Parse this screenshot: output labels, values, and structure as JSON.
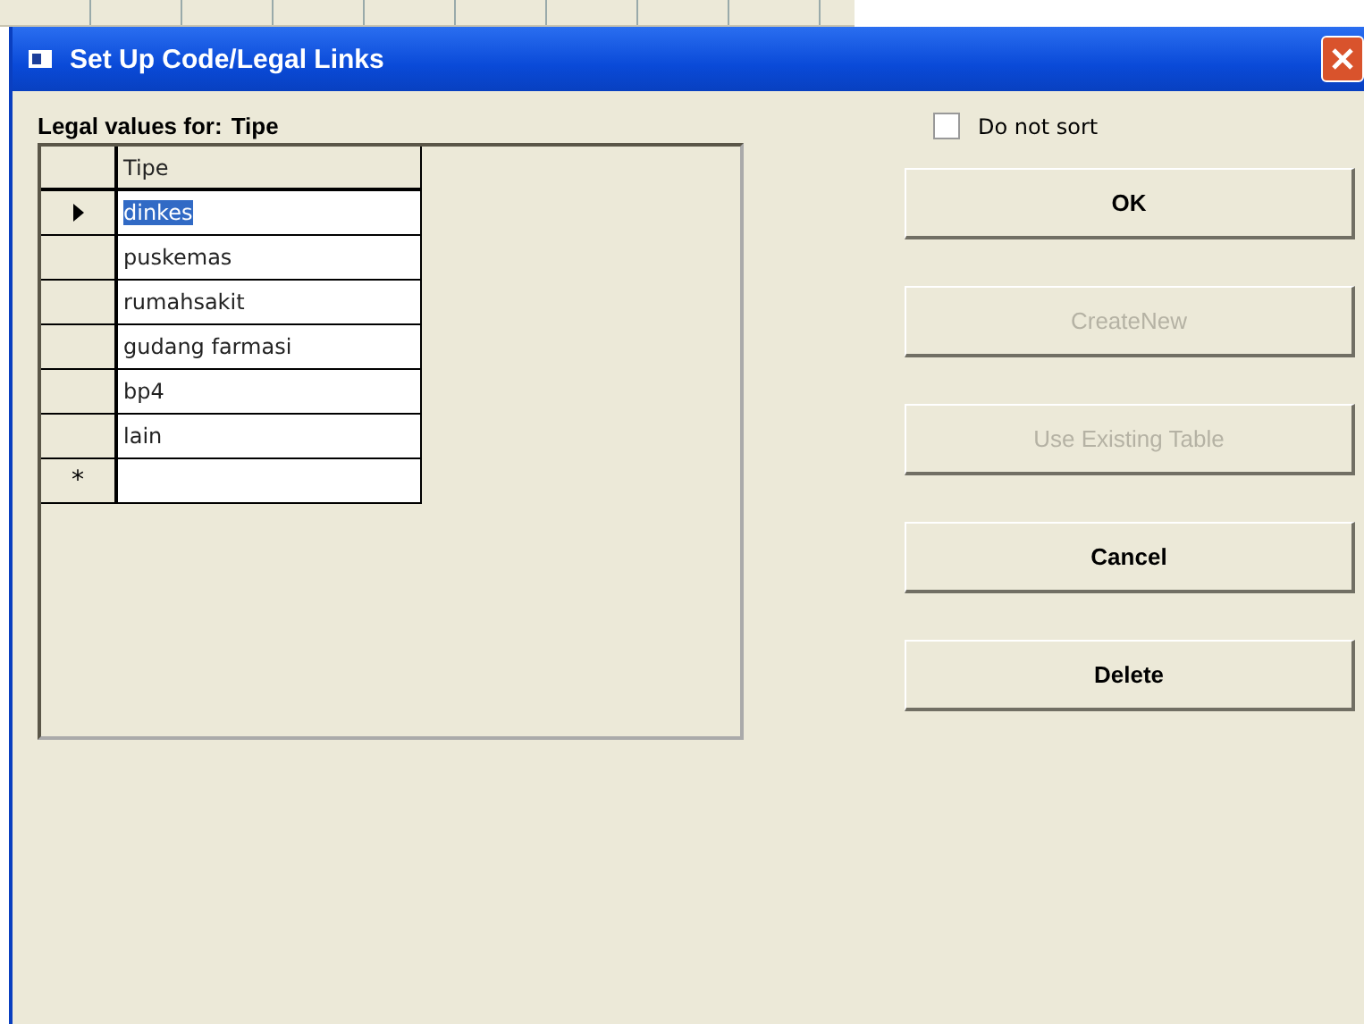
{
  "window": {
    "title": "Set Up Code/Legal Links"
  },
  "legal_label": {
    "caption": "Legal values for:",
    "field": "Tipe"
  },
  "grid": {
    "column": "Tipe",
    "rows": [
      {
        "value": "dinkes",
        "selected": true
      },
      {
        "value": "puskemas",
        "selected": false
      },
      {
        "value": "rumahsakit",
        "selected": false
      },
      {
        "value": "gudang farmasi",
        "selected": false
      },
      {
        "value": "bp4",
        "selected": false
      },
      {
        "value": "lain",
        "selected": false
      }
    ],
    "new_row_marker": "*"
  },
  "do_not_sort": {
    "label": "Do not sort",
    "checked": false
  },
  "buttons": [
    {
      "label": "OK",
      "disabled": false
    },
    {
      "label": "CreateNew",
      "disabled": true
    },
    {
      "label": "Use Existing Table",
      "disabled": true
    },
    {
      "label": "Cancel",
      "disabled": false
    },
    {
      "label": "Delete",
      "disabled": false
    }
  ]
}
